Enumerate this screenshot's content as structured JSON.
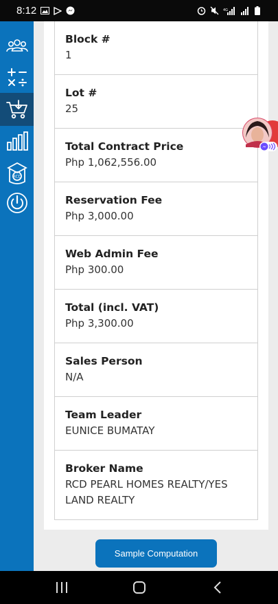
{
  "status": {
    "time": "8:12"
  },
  "details": [
    {
      "label": "Block #",
      "value": "1"
    },
    {
      "label": "Lot #",
      "value": "25"
    },
    {
      "label": "Total Contract Price",
      "value": "Php 1,062,556.00"
    },
    {
      "label": "Reservation Fee",
      "value": "Php 3,000.00"
    },
    {
      "label": "Web Admin Fee",
      "value": "Php 300.00"
    },
    {
      "label": "Total (incl. VAT)",
      "value": "Php 3,300.00"
    },
    {
      "label": "Sales Person",
      "value": "N/A"
    },
    {
      "label": "Team Leader",
      "value": "EUNICE BUMATAY"
    },
    {
      "label": "Broker Name",
      "value": "RCD PEARL HOMES REALTY/YES LAND REALTY"
    }
  ],
  "actions": {
    "sample_computation": "Sample Computation"
  },
  "sidebar": {
    "items": [
      {
        "icon": "users-icon"
      },
      {
        "icon": "calculator-icon"
      },
      {
        "icon": "cart-download-icon"
      },
      {
        "icon": "bar-chart-icon"
      },
      {
        "icon": "academy-icon"
      },
      {
        "icon": "power-icon"
      }
    ]
  },
  "colors": {
    "primary": "#0b73bc",
    "sidebar_active": "#134c78"
  }
}
